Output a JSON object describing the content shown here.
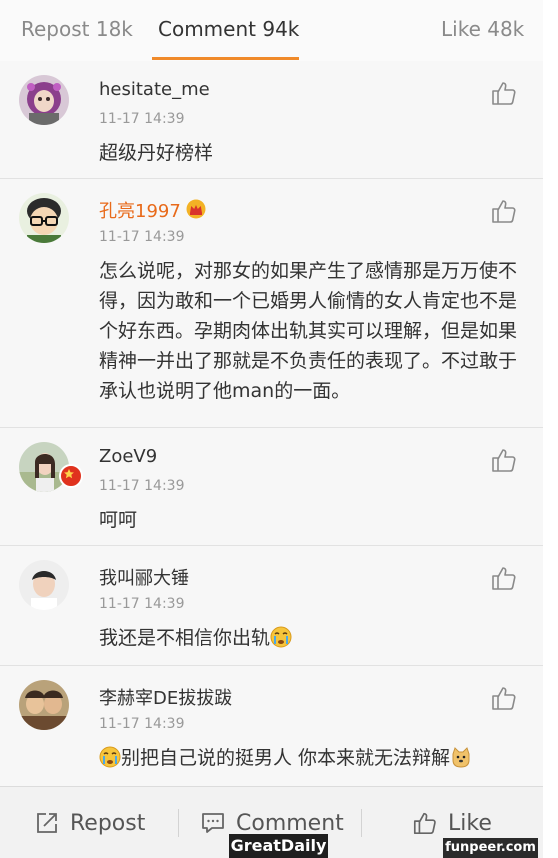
{
  "tabs": {
    "repost": "Repost 18k",
    "comment": "Comment 94k",
    "like": "Like 48k",
    "active": "comment"
  },
  "comments": [
    {
      "username": "hesitate_me",
      "time": "11-17 14:39",
      "text": "超级丹好榜样",
      "avatar": "avatar-pink-ape",
      "vip": false,
      "verified": false
    },
    {
      "username": "孔亮1997",
      "time": "11-17 14:39",
      "text": "怎么说呢，对那女的如果产生了感情那是万万使不得，因为敢和一个已婚男人偷情的女人肯定也不是个好东西。孕期肉体出轨其实可以理解，但是如果精神一并出了那就是不负责任的表现了。不过敢于承认也说明了他man的一面。",
      "avatar": "avatar-cartoon-glasses",
      "vip": true,
      "verified": false
    },
    {
      "username": "ZoeV9",
      "time": "11-17 14:39",
      "text": "呵呵",
      "avatar": "avatar-girl-outdoor",
      "vip": false,
      "verified": true
    },
    {
      "username": "我叫郦大锤",
      "time": "11-17 14:39",
      "text": "我还是不相信你出轨",
      "avatar": "avatar-young-man",
      "vip": false,
      "verified": false,
      "trailing_emoji": "crying-face"
    },
    {
      "username": "李赫宰DE拔拔跋",
      "time": "11-17 14:39",
      "text": "别把自己说的挺男人 你本来就无法辩解",
      "avatar": "avatar-two-people",
      "vip": false,
      "verified": false,
      "leading_emoji": "crying-face",
      "trailing_emoji": "doge-face"
    }
  ],
  "bottom_bar": {
    "repost": "Repost",
    "comment": "Comment",
    "like": "Like"
  },
  "watermarks": {
    "left": "GreatDaily",
    "right": "funpeer.com"
  },
  "colors": {
    "accent": "#f08a2a",
    "vip_name": "#e86a1a",
    "verified": "#e0321e"
  }
}
